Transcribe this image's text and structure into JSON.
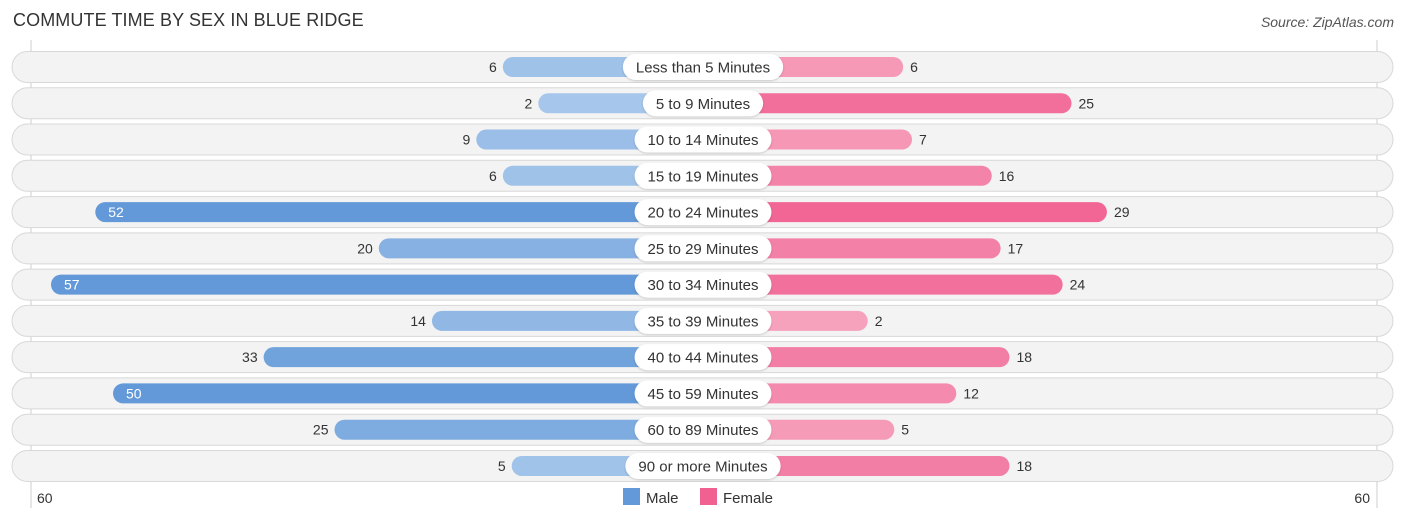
{
  "header": {
    "title": "COMMUTE TIME BY SEX IN BLUE RIDGE",
    "source": "Source: ZipAtlas.com"
  },
  "colors": {
    "male_dark": "#6399d8",
    "male_light": "#a9c9ec",
    "female_dark": "#f06090",
    "female_light": "#f6a6c0",
    "row_bg": "#f3f3f3",
    "gridline": "#cccccc"
  },
  "chart_data": {
    "type": "bar",
    "orientation": "horizontal-diverging",
    "title": "COMMUTE TIME BY SEX IN BLUE RIDGE",
    "categories": [
      "Less than 5 Minutes",
      "5 to 9 Minutes",
      "10 to 14 Minutes",
      "15 to 19 Minutes",
      "20 to 24 Minutes",
      "25 to 29 Minutes",
      "30 to 34 Minutes",
      "35 to 39 Minutes",
      "40 to 44 Minutes",
      "45 to 59 Minutes",
      "60 to 89 Minutes",
      "90 or more Minutes"
    ],
    "series": [
      {
        "name": "Male",
        "side": "left",
        "values": [
          6,
          2,
          9,
          6,
          52,
          20,
          57,
          14,
          33,
          50,
          25,
          5
        ]
      },
      {
        "name": "Female",
        "side": "right",
        "values": [
          6,
          25,
          7,
          16,
          29,
          17,
          24,
          2,
          18,
          12,
          5,
          18
        ]
      }
    ],
    "axis": {
      "left_max_label": "60",
      "right_max_label": "60",
      "max": 60
    },
    "legend": {
      "placement": "bottom-center",
      "entries": [
        "Male",
        "Female"
      ]
    },
    "grid": false
  }
}
